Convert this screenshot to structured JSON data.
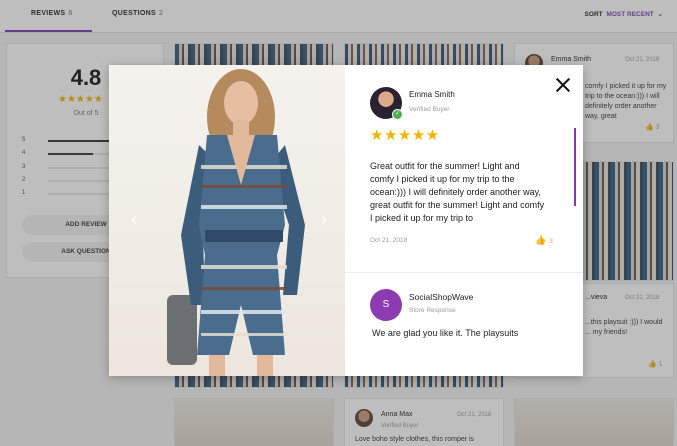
{
  "tabs": {
    "reviews_label": "REVIEWS",
    "reviews_count": "6",
    "questions_label": "QUESTIONS",
    "questions_count": "2"
  },
  "sort": {
    "label": "SORT",
    "value": "MOST RECENT"
  },
  "summary": {
    "average": "4.8",
    "stars": "★★★★★",
    "out_of": "Out of 5",
    "distribution": [
      {
        "label": "5",
        "fraction": 0.83
      },
      {
        "label": "4",
        "fraction": 0.5
      },
      {
        "label": "3",
        "fraction": 0
      },
      {
        "label": "2",
        "fraction": 0
      },
      {
        "label": "1",
        "fraction": 0
      }
    ],
    "add_review": "ADD REVIEW",
    "ask_question": "ASK QUESTION"
  },
  "background_cards": {
    "card1": {
      "name": "Emma Smith",
      "date": "Oct 21, 2018",
      "text": "comfy I picked it up for my trip to the ocean:))) I will definitely order another way, great",
      "likes": "3"
    },
    "card2": {
      "name": "...vieva",
      "date": "Oct 21, 2018",
      "text": "...this playsuit :))) I would ... my friends!",
      "likes": "1"
    },
    "card3": {
      "name": "Anna Max",
      "sub": "Verified Buyer",
      "date": "Oct 21, 2018",
      "text": "Love boho style clothes, this romper is"
    }
  },
  "modal": {
    "prev_arrow": "‹",
    "next_arrow": "›",
    "reviewer_name": "Emma Smith",
    "reviewer_status": "Verified Buyer",
    "stars": "★★★★★",
    "review_text": "Great outfit for the summer! Light and comfy I picked it up for my trip to the ocean:))) I will definitely order another way, great outfit for the summer! Light and comfy I picked it up for my trip to",
    "date": "Oct 21, 2018",
    "likes": "3",
    "thumb_icon": "👍",
    "response": {
      "avatar_letter": "S",
      "name": "SocialShopWave",
      "role": "Store Response",
      "text": "We are glad you like it. The playsuits"
    }
  },
  "colors": {
    "accent": "#7b3bb0",
    "star": "#f1b400",
    "verified": "#4caf50"
  }
}
